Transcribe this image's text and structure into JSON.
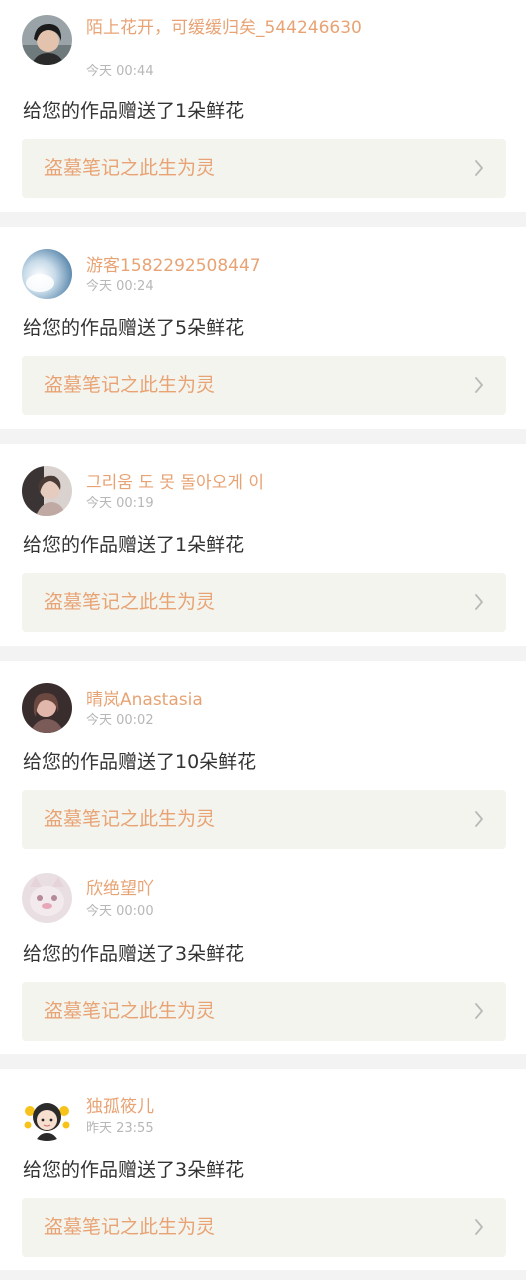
{
  "notifications": [
    {
      "username": "陌上花开，可缓缓归矣_544246630",
      "time": "今天 00:44",
      "message": "给您的作品赠送了1朵鲜花",
      "work_title": "盗墓笔记之此生为灵",
      "avatar_icon": "avatar-dark-hair-portrait"
    },
    {
      "username": "游客1582292508447",
      "time": "今天 00:24",
      "message": "给您的作品赠送了5朵鲜花",
      "work_title": "盗墓笔记之此生为灵",
      "avatar_icon": "avatar-blue-sky-photo"
    },
    {
      "username": "그리움 도 못 돌아오게 이",
      "time": "今天 00:19",
      "message": "给您的作品赠送了1朵鲜花",
      "work_title": "盗墓笔记之此生为灵",
      "avatar_icon": "avatar-girl-portrait"
    },
    {
      "username": "晴岚Anastasia",
      "time": "今天 00:02",
      "message": "给您的作品赠送了10朵鲜花",
      "work_title": "盗墓笔记之此生为灵",
      "avatar_icon": "avatar-dark-girl-portrait"
    },
    {
      "username": "欣绝望吖",
      "time": "今天 00:00",
      "message": "给您的作品赠送了3朵鲜花",
      "work_title": "盗墓笔记之此生为灵",
      "avatar_icon": "avatar-cat-photo"
    },
    {
      "username": "独孤筱儿",
      "time": "昨天 23:55",
      "message": "给您的作品赠送了3朵鲜花",
      "work_title": "盗墓笔记之此生为灵",
      "avatar_icon": "avatar-cartoon-girl-yellow"
    }
  ],
  "colors": {
    "accent": "#e8a374",
    "divider": "#f3f3f3",
    "link_background": "#f4f4ee",
    "timestamp": "#b7b7b7",
    "message_text": "#333333"
  }
}
